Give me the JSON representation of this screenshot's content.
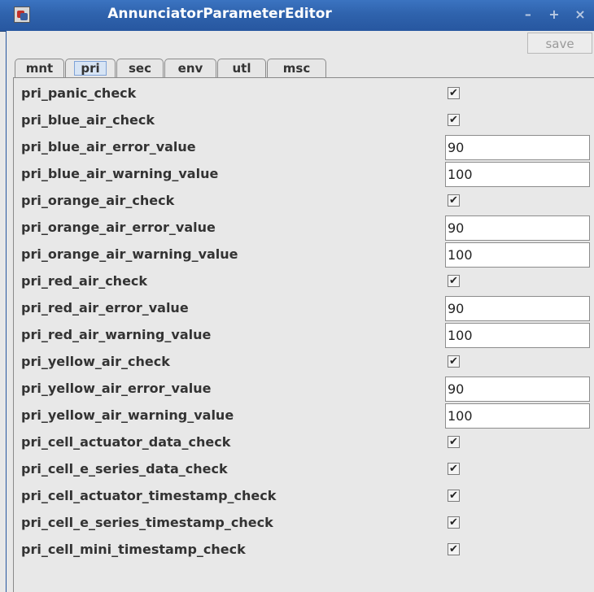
{
  "window": {
    "title": "AnnunciatorParameterEditor",
    "buttons": {
      "minimize": "–",
      "maximize": "+",
      "close": "×"
    }
  },
  "toolbar": {
    "save_label": "save"
  },
  "tabs": [
    {
      "label": "mnt",
      "active": false
    },
    {
      "label": "pri",
      "active": true
    },
    {
      "label": "sec",
      "active": false
    },
    {
      "label": "env",
      "active": false
    },
    {
      "label": "utl",
      "active": false
    },
    {
      "label": "msc",
      "active": false
    }
  ],
  "params": [
    {
      "label": "pri_panic_check",
      "type": "checkbox",
      "checked": true
    },
    {
      "label": "pri_blue_air_check",
      "type": "checkbox",
      "checked": true
    },
    {
      "label": "pri_blue_air_error_value",
      "type": "text",
      "value": "90"
    },
    {
      "label": "pri_blue_air_warning_value",
      "type": "text",
      "value": "100"
    },
    {
      "label": "pri_orange_air_check",
      "type": "checkbox",
      "checked": true
    },
    {
      "label": "pri_orange_air_error_value",
      "type": "text",
      "value": "90"
    },
    {
      "label": "pri_orange_air_warning_value",
      "type": "text",
      "value": "100"
    },
    {
      "label": "pri_red_air_check",
      "type": "checkbox",
      "checked": true
    },
    {
      "label": "pri_red_air_error_value",
      "type": "text",
      "value": "90"
    },
    {
      "label": "pri_red_air_warning_value",
      "type": "text",
      "value": "100"
    },
    {
      "label": "pri_yellow_air_check",
      "type": "checkbox",
      "checked": true
    },
    {
      "label": "pri_yellow_air_error_value",
      "type": "text",
      "value": "90"
    },
    {
      "label": "pri_yellow_air_warning_value",
      "type": "text",
      "value": "100"
    },
    {
      "label": "pri_cell_actuator_data_check",
      "type": "checkbox",
      "checked": true
    },
    {
      "label": "pri_cell_e_series_data_check",
      "type": "checkbox",
      "checked": true
    },
    {
      "label": "pri_cell_actuator_timestamp_check",
      "type": "checkbox",
      "checked": true
    },
    {
      "label": "pri_cell_e_series_timestamp_check",
      "type": "checkbox",
      "checked": true
    },
    {
      "label": "pri_cell_mini_timestamp_check",
      "type": "checkbox",
      "checked": true
    }
  ],
  "check_glyph": "✔",
  "colors": {
    "titlebar": "#2f63ad",
    "frame_border": "#2757a0",
    "tab_highlight": "#d7e4f4"
  }
}
